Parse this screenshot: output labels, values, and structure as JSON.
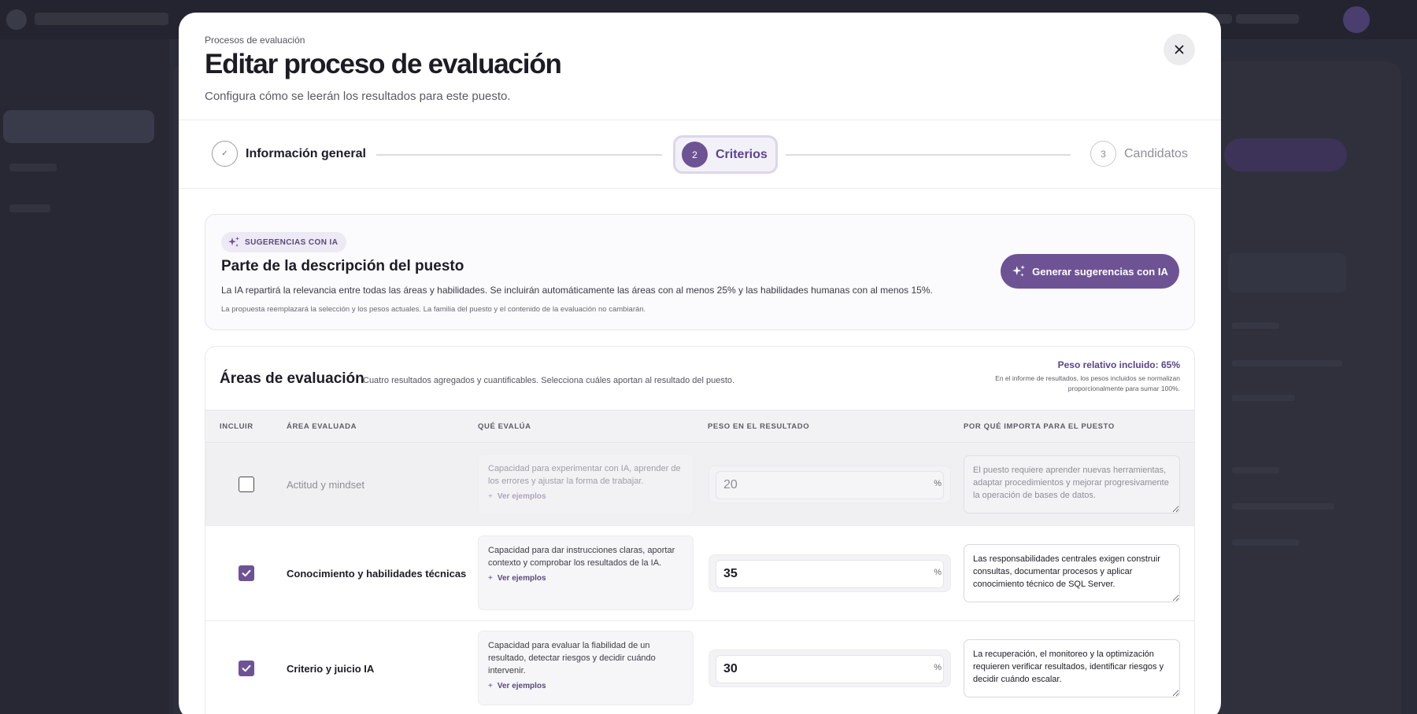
{
  "modal": {
    "breadcrumb": "Procesos de evaluación",
    "title": "Editar proceso de evaluación",
    "subtitle": "Configura cómo se leerán los resultados para este puesto."
  },
  "stepper": {
    "steps": [
      {
        "marker": "✓",
        "label": "Información general",
        "state": "completed"
      },
      {
        "marker": "2",
        "label": "Criterios",
        "state": "active"
      },
      {
        "marker": "3",
        "label": "Candidatos",
        "state": "pending"
      }
    ]
  },
  "ai_card": {
    "badge": "SUGERENCIAS CON IA",
    "title": "Parte de la descripción del puesto",
    "text": "La IA repartirá la relevancia entre todas las áreas y habilidades. Se incluirán automáticamente las áreas con al menos 25% y las habilidades humanas con al menos 15%.",
    "note": "La propuesta reemplazará la selección y los pesos actuales. La familia del puesto y el contenido de la evaluación no cambiarán.",
    "button_label": "Generar sugerencias con IA"
  },
  "areas": {
    "title": "Áreas de evaluación",
    "description": "Cuatro resultados agregados y cuantificables. Selecciona cuáles aportan al resultado del puesto.",
    "weight_total": "Peso relativo incluido: 65%",
    "weight_note_line1": "En el informe de resultados, los pesos incluidos se normalizan",
    "weight_note_line2": "proporcionalmente para sumar 100%.",
    "columns": [
      "INCLUIR",
      "ÁREA EVALUADA",
      "QUÉ EVALÚA",
      "PESO EN EL RESULTADO",
      "POR QUÉ IMPORTA PARA EL PUESTO"
    ],
    "see_examples": "Ver ejemplos",
    "percent_sign": "%",
    "rows": [
      {
        "included": false,
        "area": "Actitud y mindset",
        "evaluates": "Capacidad para experimentar con IA, aprender de los errores y ajustar la forma de trabajar.",
        "weight": "20",
        "reason": "El puesto requiere aprender nuevas herramientas, adaptar procedimientos y mejorar progresivamente la operación de bases de datos."
      },
      {
        "included": true,
        "area": "Conocimiento y habilidades técnicas",
        "evaluates": "Capacidad para dar instrucciones claras, aportar contexto y comprobar los resultados de la IA.",
        "weight": "35",
        "reason": "Las responsabilidades centrales exigen construir consultas, documentar procesos y aplicar conocimiento técnico de SQL Server."
      },
      {
        "included": true,
        "area": "Criterio y juicio IA",
        "evaluates": "Capacidad para evaluar la fiabilidad de un resultado, detectar riesgos y decidir cuándo intervenir.",
        "weight": "30",
        "reason": "La recuperación, el monitoreo y la optimización requieren verificar resultados, identificar riesgos y decidir cuándo escalar."
      }
    ]
  },
  "colors": {
    "accent": "#6e5394",
    "accent_text": "#5b4390",
    "overlay_bg": "#2a2b38"
  }
}
